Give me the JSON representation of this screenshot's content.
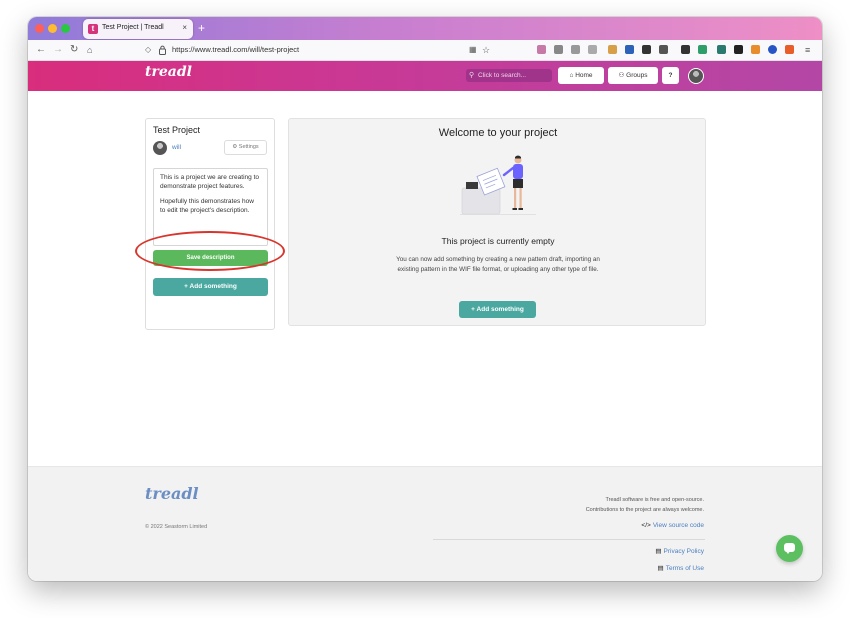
{
  "browser": {
    "tab_title": "Test Project | Treadl",
    "tab_close": "×",
    "new_tab": "+",
    "url": "https://www.treadl.com/will/test-project",
    "traffic_colors": [
      "#fe5f57",
      "#febc2e",
      "#28c840"
    ]
  },
  "header": {
    "logo": "treadl",
    "search_placeholder": "Click to search...",
    "home_label": "Home",
    "groups_label": "Groups",
    "help_label": "?"
  },
  "project": {
    "title": "Test Project",
    "owner": "will",
    "settings_label": "Settings",
    "description": [
      "This is a project we are creating to demonstrate project features.",
      "Hopefully this demonstrates how to edit the project's description."
    ],
    "save_label": "Save description",
    "add_label": "Add something"
  },
  "main": {
    "welcome": "Welcome to your project",
    "empty_title": "This project is currently empty",
    "empty_text": "You can now add something by creating a new pattern draft, importing an existing pattern in the WIF file format, or uploading any other type of file.",
    "add_label": "Add something"
  },
  "footer": {
    "logo": "treadl",
    "copyright": "© 2022 Seastorm Limited",
    "note_line1": "Treadl software is free and open-source.",
    "note_line2": "Contributions to the project are always welcome.",
    "source_label": "View source code",
    "privacy_label": "Privacy Policy",
    "terms_label": "Terms of Use"
  },
  "colors": {
    "header_start": "#d92d7d",
    "header_end": "#b447a6",
    "save_green": "#5cb85c",
    "add_teal": "#4aa8a0",
    "link_blue": "#4a7fc1",
    "annotation_red": "#d8362c",
    "chat_green": "#5cc060"
  }
}
